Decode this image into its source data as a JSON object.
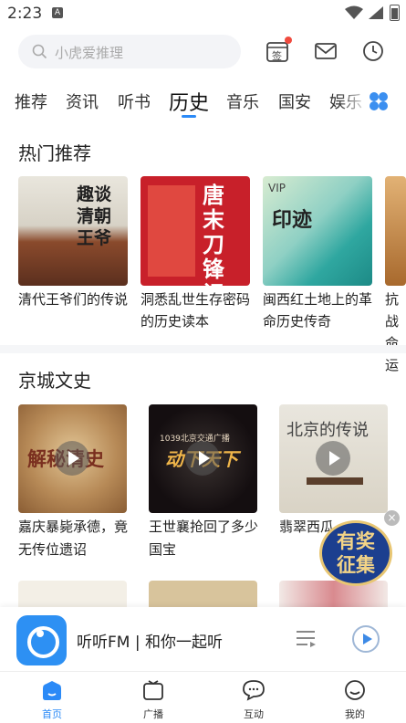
{
  "status_bar": {
    "time": "2:23",
    "notif": "A"
  },
  "search": {
    "placeholder": "小虎爱推理"
  },
  "header_icons": {
    "sign_in": "签"
  },
  "tabs": [
    {
      "label": "推荐"
    },
    {
      "label": "资讯"
    },
    {
      "label": "听书"
    },
    {
      "label": "历史"
    },
    {
      "label": "音乐"
    },
    {
      "label": "国安"
    },
    {
      "label": "娱乐"
    }
  ],
  "hot": {
    "title": "热门推荐",
    "items": [
      {
        "label": "清代王爷们的传说",
        "cover_text": "趣谈清朝王爷"
      },
      {
        "label": "洞悉乱世生存密码的历史读本",
        "cover_text": "唐末刀锋记"
      },
      {
        "label": "闽西红土地上的革命历史传奇",
        "cover_text": "印迹",
        "badge": "VIP"
      },
      {
        "label": "抗战命运"
      }
    ]
  },
  "jingcheng": {
    "title": "京城文史",
    "items": [
      {
        "label": "嘉庆暴毙承德，竟无传位遗诏",
        "cover_text": "解秘清史"
      },
      {
        "label": "王世襄抢回了多少国宝",
        "cover_text": "动下天下",
        "cover_sub": "1039北京交通广播"
      },
      {
        "label": "翡翠西瓜",
        "cover_text": "北京的传说"
      }
    ]
  },
  "promo": {
    "line1": "有奖",
    "line2": "征集",
    "close": "×"
  },
  "player": {
    "title": "听听FM | 和你一起听"
  },
  "nav": [
    {
      "label": "首页"
    },
    {
      "label": "广播"
    },
    {
      "label": "互动"
    },
    {
      "label": "我的"
    }
  ],
  "colors": {
    "accent": "#2b8af7",
    "red_dot": "#f04a3e",
    "promo_bg": "#1c3f8f"
  }
}
